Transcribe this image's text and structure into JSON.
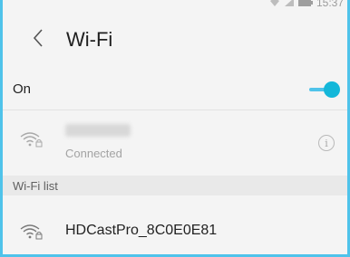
{
  "status_bar": {
    "time": "15:37",
    "icons": [
      "wifi-signal-icon",
      "cell-signal-icon",
      "battery-icon"
    ]
  },
  "header": {
    "back_icon": "chevron-left-icon",
    "title": "Wi-Fi"
  },
  "wifi_toggle": {
    "label": "On",
    "state": "on",
    "accent_color": "#14b7d9"
  },
  "connected_network": {
    "ssid": "",
    "status": "Connected",
    "icon": "wifi-locked-icon",
    "info_icon": "info-icon",
    "info_glyph": "i"
  },
  "wifi_list": {
    "section_label": "Wi-Fi list",
    "networks": [
      {
        "ssid": "HDCastPro_8C0E0E81",
        "icon": "wifi-locked-icon"
      }
    ]
  },
  "colors": {
    "accent": "#4fc3ea",
    "background": "#f4f4f4",
    "section_bg": "#e9e9e9"
  }
}
